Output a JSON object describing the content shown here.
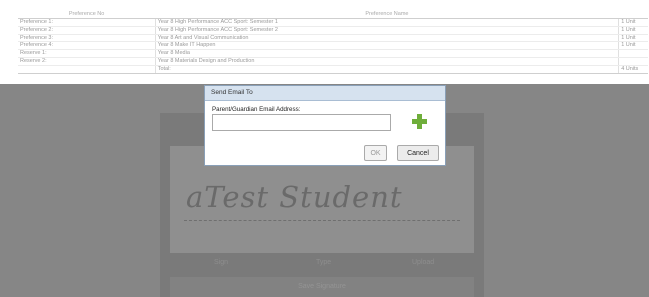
{
  "table": {
    "headers": [
      "Preference No",
      "Preference Name",
      ""
    ],
    "rows": [
      [
        "Preference 1:",
        "Year 8 High Performance ACC Sport: Semester 1",
        "1 Unit"
      ],
      [
        "Preference 2:",
        "Year 8 High Performance ACC Sport: Semester 2",
        "1 Unit"
      ],
      [
        "Preference 3:",
        "Year 8 Art and Visual Communication",
        "1 Unit"
      ],
      [
        "Preference 4:",
        "Year 8 Make IT Happen",
        "1 Unit"
      ],
      [
        "Reserve 1:",
        "Year 8 Media",
        ""
      ],
      [
        "Reserve 2:",
        "Year 8 Materials Design and Production",
        ""
      ]
    ],
    "total_label": "Total:",
    "total_value": "4 Units"
  },
  "signature": {
    "name": "aTest Student",
    "tabs": [
      "Sign",
      "Type",
      "Upload"
    ],
    "save_label": "Save Signature"
  },
  "dialog": {
    "title": "Send Email To",
    "field_label": "Parent/Guardian Email Address:",
    "field_value": "",
    "ok_label": "OK",
    "cancel_label": "Cancel",
    "add_icon": "plus-icon",
    "add_icon_color": "#6fae3b"
  }
}
